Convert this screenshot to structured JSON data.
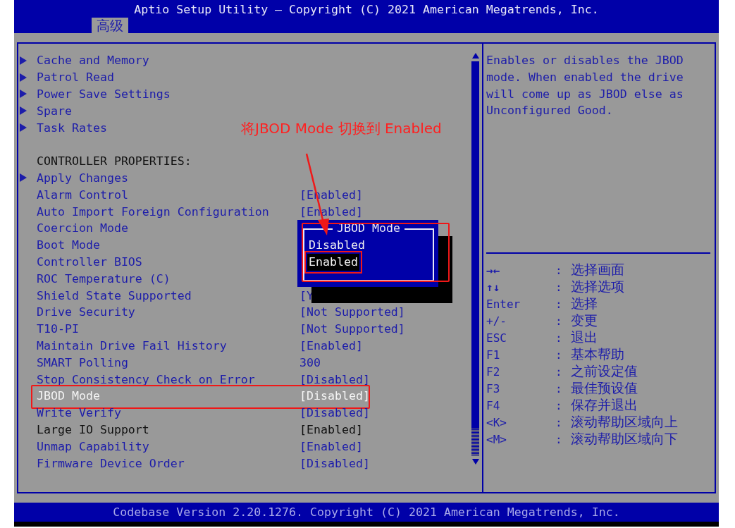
{
  "window": {
    "title": "Aptio Setup Utility – Copyright (C) 2021 American Megatrends, Inc."
  },
  "tabs": [
    {
      "label": "高级",
      "selected": true
    }
  ],
  "items": [
    {
      "kind": "submenu",
      "label": "Cache and Memory",
      "selected": false,
      "editable": true,
      "highlighted": false
    },
    {
      "kind": "submenu",
      "label": "Patrol Read",
      "selected": false,
      "editable": true,
      "highlighted": false
    },
    {
      "kind": "submenu",
      "label": "Power Save Settings",
      "selected": false,
      "editable": true,
      "highlighted": false
    },
    {
      "kind": "submenu",
      "label": "Spare",
      "selected": false,
      "editable": true,
      "highlighted": false
    },
    {
      "kind": "submenu",
      "label": "Task Rates",
      "selected": false,
      "editable": true,
      "highlighted": false
    },
    {
      "kind": "header",
      "label": "CONTROLLER PROPERTIES:",
      "selected": false,
      "editable": false,
      "highlighted": false
    },
    {
      "kind": "submenu",
      "label": "Apply Changes",
      "selected": false,
      "editable": true,
      "highlighted": false
    },
    {
      "kind": "setting",
      "label": "Alarm Control",
      "value": "[Enabled]",
      "selected": false,
      "editable": true,
      "highlighted": false
    },
    {
      "kind": "setting",
      "label": "Auto Import Foreign Configuration",
      "value": "[Enabled]",
      "selected": false,
      "editable": true,
      "highlighted": false
    },
    {
      "kind": "setting",
      "label": "Coercion Mode",
      "selected": false,
      "editable": true,
      "highlighted": false
    },
    {
      "kind": "setting",
      "label": "Boot Mode",
      "selected": false,
      "editable": true,
      "highlighted": false
    },
    {
      "kind": "setting",
      "label": "Controller BIOS",
      "selected": false,
      "editable": true,
      "highlighted": false
    },
    {
      "kind": "setting",
      "label": "ROC Temperature (C)",
      "selected": false,
      "editable": true,
      "highlighted": false
    },
    {
      "kind": "setting",
      "label": "Shield State Supported",
      "value": "[Y",
      "selected": false,
      "editable": true,
      "highlighted": false
    },
    {
      "kind": "setting",
      "label": "Drive Security",
      "value": "[Not Supported]",
      "selected": false,
      "editable": true,
      "highlighted": false
    },
    {
      "kind": "setting",
      "label": "T10-PI",
      "value": "[Not Supported]",
      "selected": false,
      "editable": true,
      "highlighted": false
    },
    {
      "kind": "setting",
      "label": "Maintain Drive Fail History",
      "value": "[Enabled]",
      "selected": false,
      "editable": true,
      "highlighted": false
    },
    {
      "kind": "setting",
      "label": "SMART Polling",
      "value": "300",
      "selected": false,
      "editable": true,
      "highlighted": false
    },
    {
      "kind": "setting",
      "label": "Stop Consistency Check on Error",
      "value": "[Disabled]",
      "selected": false,
      "editable": true,
      "highlighted": false
    },
    {
      "kind": "setting",
      "label": "JBOD Mode",
      "value": "[Disabled]",
      "selected": true,
      "editable": true,
      "highlighted": true
    },
    {
      "kind": "setting",
      "label": "Write Verify",
      "value": "[Disabled]",
      "selected": false,
      "editable": true,
      "highlighted": false
    },
    {
      "kind": "setting",
      "label": "Large IO Support",
      "value": "[Enabled]",
      "selected": false,
      "editable": false,
      "highlighted": false
    },
    {
      "kind": "setting",
      "label": "Unmap Capability",
      "value": "[Enabled]",
      "selected": false,
      "editable": true,
      "highlighted": false
    },
    {
      "kind": "setting",
      "label": "Firmware Device Order",
      "value": "[Disabled]",
      "selected": false,
      "editable": true,
      "highlighted": false
    }
  ],
  "popup": {
    "title": "JBOD Mode",
    "highlighted": true,
    "options": [
      {
        "label": "Disabled",
        "selected": false,
        "highlighted": false
      },
      {
        "label": "Enabled",
        "selected": true,
        "highlighted": true
      }
    ]
  },
  "annotation": {
    "text": "将JBOD Mode 切换到 Enabled"
  },
  "help": {
    "text": "Enables or disables the JBOD mode. When enabled the drive will come up as JBOD else as Unconfigured Good."
  },
  "keys": [
    {
      "key": "→←",
      "action": "选择画面"
    },
    {
      "key": "↑↓",
      "action": "选择选项"
    },
    {
      "key": "Enter",
      "action": "选择"
    },
    {
      "key": "+/-",
      "action": "变更"
    },
    {
      "key": "ESC",
      "action": "退出"
    },
    {
      "key": "F1",
      "action": "基本帮助"
    },
    {
      "key": "F2",
      "action": "之前设定值"
    },
    {
      "key": "F3",
      "action": "最佳预设值"
    },
    {
      "key": "F4",
      "action": "保存并退出"
    },
    {
      "key": "<K>",
      "action": "滚动帮助区域向上"
    },
    {
      "key": "<M>",
      "action": "滚动帮助区域向下"
    }
  ],
  "key_separator": ":",
  "footer": {
    "text": "Codebase Version 2.20.1276. Copyright (C) 2021 American Megatrends, Inc."
  }
}
